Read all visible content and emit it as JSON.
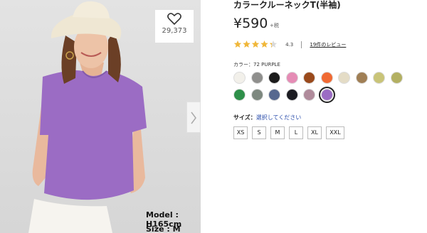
{
  "product": {
    "title": "カラークルーネックT(半袖)",
    "price": "¥590",
    "tax_note": "+税",
    "rating_value": "4.3",
    "rating_stars": 4.3,
    "review_link": "19件のレビュー"
  },
  "favorite": {
    "count": "29,373",
    "icon": "heart-icon"
  },
  "model": {
    "height_text": "Model : H165cm",
    "size_text": "Size : M"
  },
  "color": {
    "label": "カラー：72 PURPLE",
    "swatches": [
      "#f2f0ea",
      "#8f8f8d",
      "#1b1b1b",
      "#e58cb5",
      "#9a4a1c",
      "#f06a33",
      "#e4dcc6",
      "#a07f55",
      "#c9c478",
      "#b3b062",
      "#2e8f49",
      "#7d887f",
      "#56688f",
      "#1c1c22",
      "#b08b9b",
      "#9b6cc4"
    ],
    "selected_index": 15
  },
  "size": {
    "label": "サイズ：",
    "prompt": "選択してください",
    "options": [
      "XS",
      "S",
      "M",
      "L",
      "XL",
      "XXL"
    ]
  },
  "colors": {
    "shirt": "#9b6cc4",
    "star": "#f0b73a",
    "link": "#2a4dab"
  }
}
